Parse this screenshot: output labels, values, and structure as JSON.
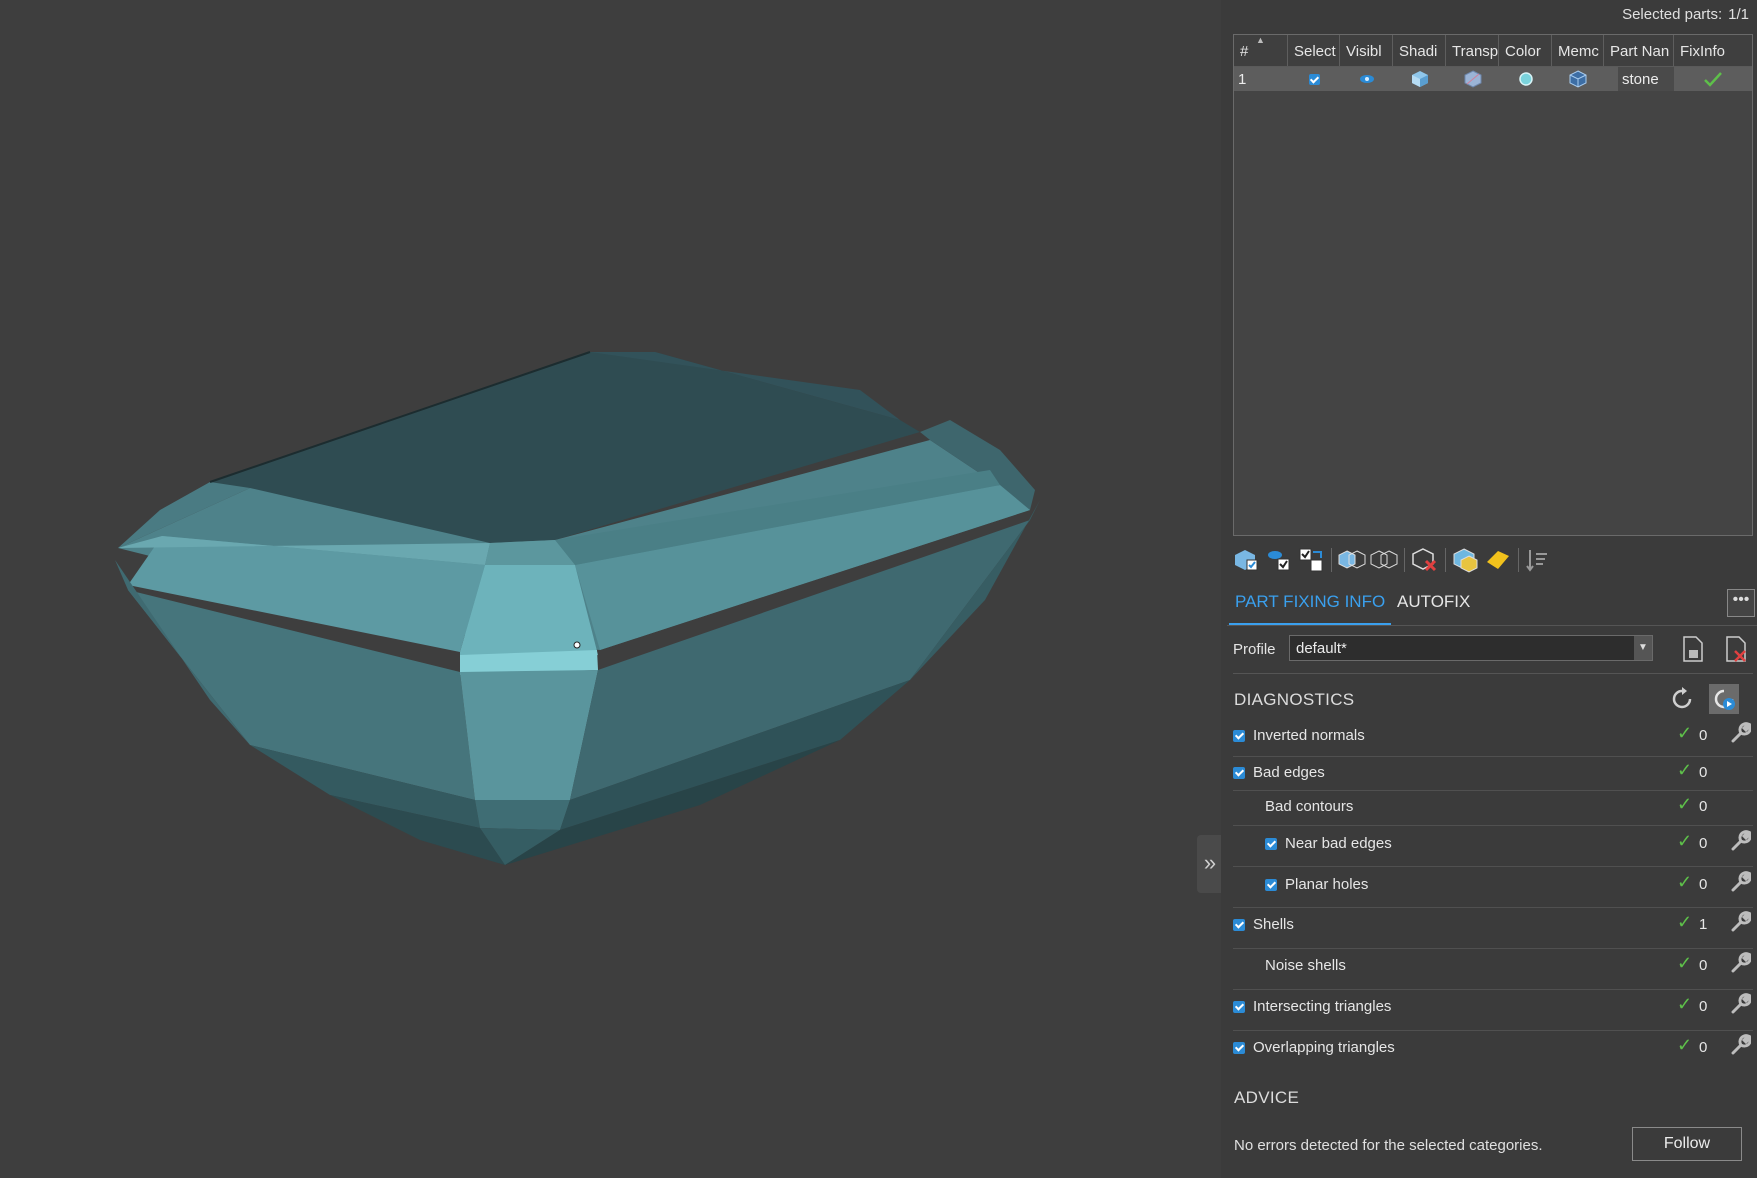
{
  "header": {
    "selected_label": "Selected parts:",
    "selected_value": "1/1"
  },
  "parts_table": {
    "columns": [
      "#",
      "Select",
      "Visible",
      "Shading",
      "Transparency",
      "Color",
      "Memory",
      "Part Name",
      "FixInfo"
    ],
    "column_display": [
      "#",
      "Select",
      "Visibl",
      "Shadi",
      "Transp",
      "Color",
      "Memc",
      "Part Nan",
      "FixInfo"
    ],
    "rows": [
      {
        "index": "1",
        "select": true,
        "visible": true,
        "color": "#7ad3dc",
        "part_name": "stone",
        "fixinfo": "ok"
      }
    ]
  },
  "toolbar": {
    "icons": [
      "select-parts-icon",
      "toggle-visibility-icon",
      "invert-selection-icon",
      "shading-on-icon",
      "shading-off-icon",
      "remove-part-icon",
      "color-parts-icon",
      "fix-tag-icon",
      "sort-icon"
    ]
  },
  "tabs": [
    {
      "label": "PART FIXING INFO",
      "active": true
    },
    {
      "label": "AUTOFIX",
      "active": false
    }
  ],
  "more_label": "•••",
  "profile": {
    "label": "Profile",
    "value": "default*"
  },
  "diagnostics": {
    "title": "DIAGNOSTICS",
    "items": [
      {
        "label": "Inverted normals",
        "checked": true,
        "indent": 0,
        "status": "ok",
        "count": "0",
        "fixable": true
      },
      {
        "label": "Bad edges",
        "checked": true,
        "indent": 0,
        "status": "ok",
        "count": "0",
        "fixable": false
      },
      {
        "label": "Bad contours",
        "checked": false,
        "indent": 1,
        "status": "ok",
        "count": "0",
        "fixable": false
      },
      {
        "label": "Near bad edges",
        "checked": true,
        "indent": 1,
        "status": "ok",
        "count": "0",
        "fixable": true
      },
      {
        "label": "Planar holes",
        "checked": true,
        "indent": 1,
        "status": "ok",
        "count": "0",
        "fixable": true
      },
      {
        "label": "Shells",
        "checked": true,
        "indent": 0,
        "status": "ok",
        "count": "1",
        "fixable": true
      },
      {
        "label": "Noise shells",
        "checked": false,
        "indent": 1,
        "status": "ok",
        "count": "0",
        "fixable": true
      },
      {
        "label": "Intersecting triangles",
        "checked": true,
        "indent": 0,
        "status": "ok",
        "count": "0",
        "fixable": true
      },
      {
        "label": "Overlapping triangles",
        "checked": true,
        "indent": 0,
        "status": "ok",
        "count": "0",
        "fixable": true
      }
    ]
  },
  "advice": {
    "title": "ADVICE",
    "message": "No errors detected for the selected categories.",
    "button": "Follow"
  },
  "viewport": {
    "collapse_glyph": "»",
    "model_color": "#5d9aa3"
  }
}
